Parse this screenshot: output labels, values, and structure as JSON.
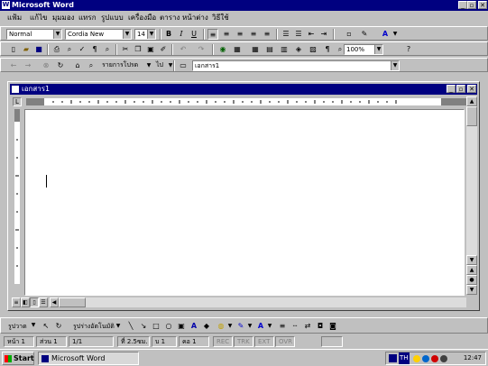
{
  "window": {
    "title": "Microsoft Word",
    "controls": {
      "minimize": "_",
      "maximize": "▫",
      "close": "✕"
    }
  },
  "menu": {
    "items": [
      "แฟ้ม",
      "แก้ไข",
      "มุมมอง",
      "แทรก",
      "รูปแบบ",
      "เครื่องมือ",
      "ตาราง",
      "หน้าต่าง",
      "วิธีใช้"
    ]
  },
  "formatting_toolbar": {
    "style": "Normal",
    "font": "Cordia New",
    "size": "14",
    "bold": "B",
    "italic": "I",
    "underline": "U"
  },
  "standard_toolbar": {
    "zoom": "100%"
  },
  "web_toolbar": {
    "back": "←",
    "forward": "→",
    "favorites": "รายการโปรด",
    "go": "ไป",
    "address": "เอกสาร1"
  },
  "document": {
    "title": "เอกสาร1"
  },
  "drawing_toolbar": {
    "draw": "รูปวาด",
    "autoshapes": "รูปร่างอัตโนมัติ"
  },
  "status_bar": {
    "page": "หน้า 1",
    "section": "ส่วน 1",
    "page_of": "1/1",
    "at": "ที่ 2.5ซม.",
    "line": "บ 1",
    "col": "คอ 1",
    "rec": "REC",
    "trk": "TRK",
    "ext": "EXT",
    "ovr": "OVR"
  },
  "taskbar": {
    "start": "Start",
    "task_word": "Microsoft Word",
    "lang": "TH",
    "clock": "12:47"
  }
}
